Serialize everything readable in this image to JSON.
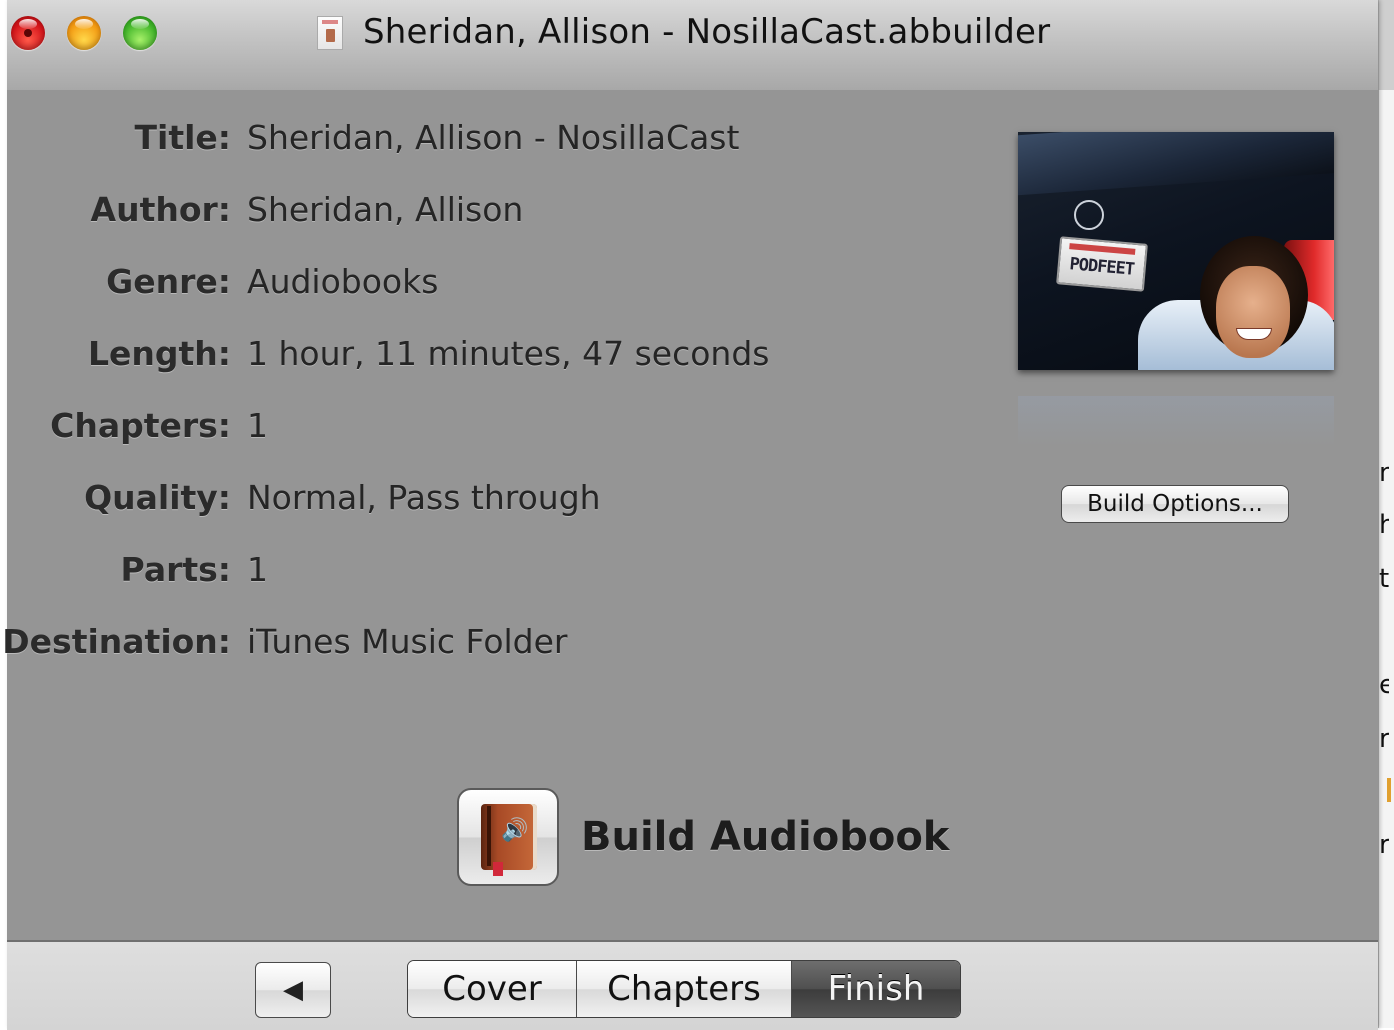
{
  "window": {
    "title": "Sheridan, Allison - NosillaCast.abbuilder"
  },
  "info": {
    "rows": [
      {
        "label": "Title:",
        "value": "Sheridan, Allison - NosillaCast"
      },
      {
        "label": "Author:",
        "value": "Sheridan, Allison"
      },
      {
        "label": "Genre:",
        "value": "Audiobooks"
      },
      {
        "label": "Length:",
        "value": "1 hour, 11 minutes, 47 seconds"
      },
      {
        "label": "Chapters:",
        "value": "1"
      },
      {
        "label": "Quality:",
        "value": "Normal, Pass through"
      },
      {
        "label": "Parts:",
        "value": "1"
      },
      {
        "label": "Destination:",
        "value": "iTunes Music Folder"
      }
    ]
  },
  "cover": {
    "plate_text": "PODFEET"
  },
  "build_options_label": "Build Options...",
  "build": {
    "label": "Build Audiobook"
  },
  "nav": {
    "back_symbol": "◀",
    "steps": [
      "Cover",
      "Chapters",
      "Finish"
    ],
    "selected": "Finish"
  },
  "background_window": {
    "chars": [
      "n",
      "h",
      "t",
      "e",
      "r",
      "r"
    ]
  },
  "icons": {
    "close": "close-traffic-light-icon",
    "minimize": "minimize-traffic-light-icon",
    "zoom": "zoom-traffic-light-icon",
    "document": "abbuilder-document-icon",
    "build": "audiobook-icon",
    "back": "back-arrow-icon"
  },
  "colors": {
    "window_bg": "#959595",
    "selected_segment": "#4f4f4f"
  }
}
